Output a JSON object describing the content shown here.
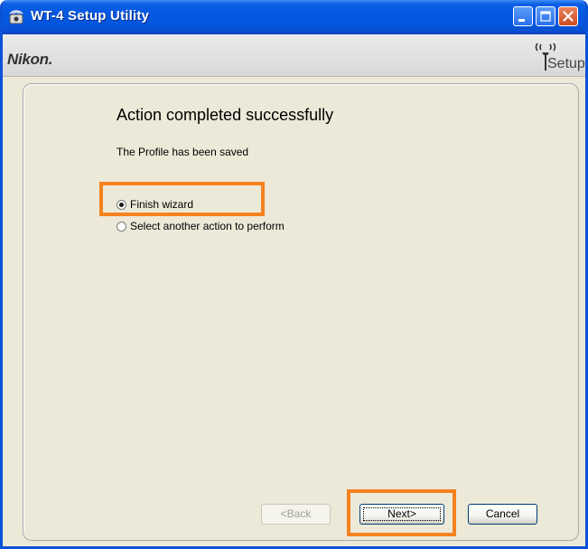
{
  "window": {
    "title": "WT-4 Setup Utility",
    "app_icon": "wifi-camera-icon",
    "controls": [
      "minimize-icon",
      "maximize-icon",
      "close-icon"
    ]
  },
  "header": {
    "brand": "Nikon.",
    "setup_logo_text": "Setup",
    "setup_logo_icon": "wireless-antenna-icon"
  },
  "content": {
    "heading": "Action completed successfully",
    "message": "The Profile has been saved",
    "options": [
      {
        "label": "Finish wizard",
        "selected": true
      },
      {
        "label": "Select another action to perform",
        "selected": false
      }
    ]
  },
  "buttons": {
    "back": "<Back",
    "next": "Next>",
    "cancel": "Cancel",
    "back_enabled": false
  },
  "colors": {
    "highlight": "#f5821f",
    "titlebar": "#0558e0",
    "close_button": "#d04a1e"
  }
}
